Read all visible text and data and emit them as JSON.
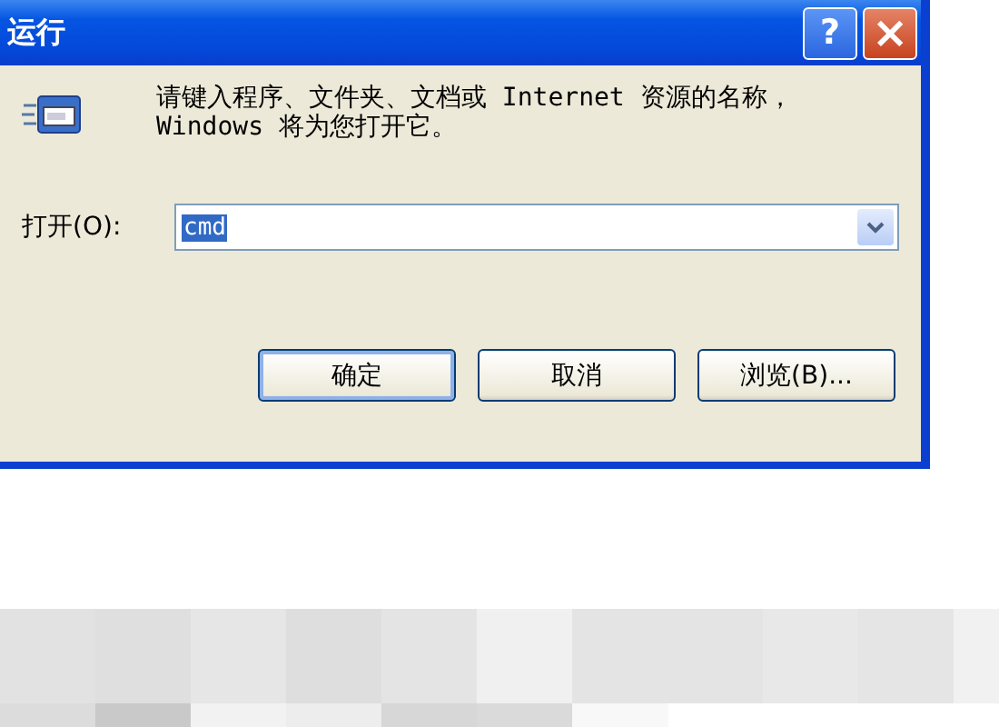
{
  "window": {
    "title": "运行",
    "help_button": "?",
    "close_button": "×"
  },
  "prompt": "请键入程序、文件夹、文档或 Internet 资源的名称，Windows 将为您打开它。",
  "open_field": {
    "label": "打开(O):",
    "value": "cmd",
    "value_selected": true
  },
  "buttons": [
    {
      "label": "确定",
      "default": true
    },
    {
      "label": "取消",
      "default": false
    },
    {
      "label": "浏览(B)...",
      "default": false
    }
  ]
}
